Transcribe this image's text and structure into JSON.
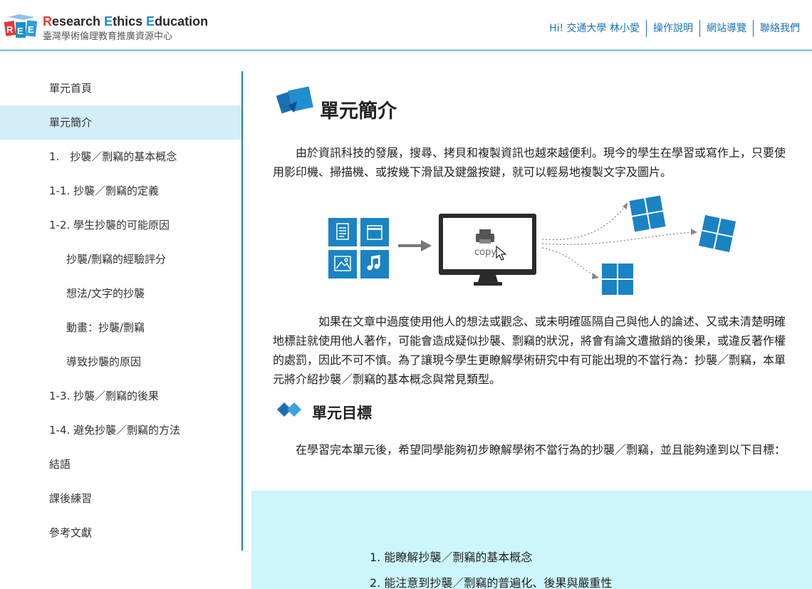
{
  "header": {
    "logo_title_parts": [
      "R",
      "esearch ",
      "E",
      "thics ",
      "E",
      "ducation"
    ],
    "logo_subtitle": "臺灣學術倫理教育推廣資源中心",
    "nav": [
      "Hi! 交通大學 林小愛",
      "操作說明",
      "網站導覽",
      "聯絡我們"
    ]
  },
  "sidebar": {
    "items": [
      {
        "label": "單元首頁"
      },
      {
        "label": "單元簡介",
        "active": true
      },
      {
        "label": "1.　抄襲／剽竊的基本概念"
      },
      {
        "label": "1-1. 抄襲／剽竊的定義"
      },
      {
        "label": "1-2. 學生抄襲的可能原因"
      },
      {
        "label": "抄襲/剽竊的經驗評分"
      },
      {
        "label": "想法/文字的抄襲"
      },
      {
        "label": "動畫：抄襲/剽竊"
      },
      {
        "label": "導致抄襲的原因"
      },
      {
        "label": "1-3. 抄襲／剽竊的後果"
      },
      {
        "label": "1-4. 避免抄襲／剽竊的方法"
      },
      {
        "label": "結語"
      },
      {
        "label": "課後練習"
      },
      {
        "label": "參考文獻"
      }
    ]
  },
  "main": {
    "title": "單元簡介",
    "paragraph1": "　　由於資訊科技的發展，搜尋、拷貝和複製資訊也越來越便利。現今的學生在學習或寫作上，只要使用影印機、掃描機、或按幾下滑鼠及鍵盤按鍵，就可以輕易地複製文字及圖片。",
    "illustration": {
      "copy_label": "copy"
    },
    "paragraph2": "　　　　如果在文章中過度使用他人的想法或觀念、或未明確區隔自己與他人的論述、又或未清楚明確地標註就使用他人著作，可能會造成疑似抄襲、剽竊的狀況，將會有論文遭撤銷的後果，或違反著作權的處罰，因此不可不慎。為了讓現今學生更瞭解學術研究中有可能出現的不當行為：抄襲／剽竊，本單元將介紹抄襲／剽竊的基本概念與常見類型。",
    "objectives_title": "單元目標",
    "paragraph3": "　　在學習完本單元後，希望同學能夠初步瞭解學術不當行為的抄襲／剽竊，並且能夠達到以下目標：",
    "goals": [
      "1.  能瞭解抄襲／剽竊的基本概念",
      "2.  能注意到抄襲／剽竊的普遍化、後果與嚴重性"
    ]
  },
  "colors": {
    "accent_blue": "#1e7fb0",
    "link_blue": "#1a73b5",
    "tile_blue": "#1a83c3",
    "active_bg": "#d3eef7",
    "goals_bg": "#ccf6fb",
    "logo_red": "#e23a3a"
  }
}
